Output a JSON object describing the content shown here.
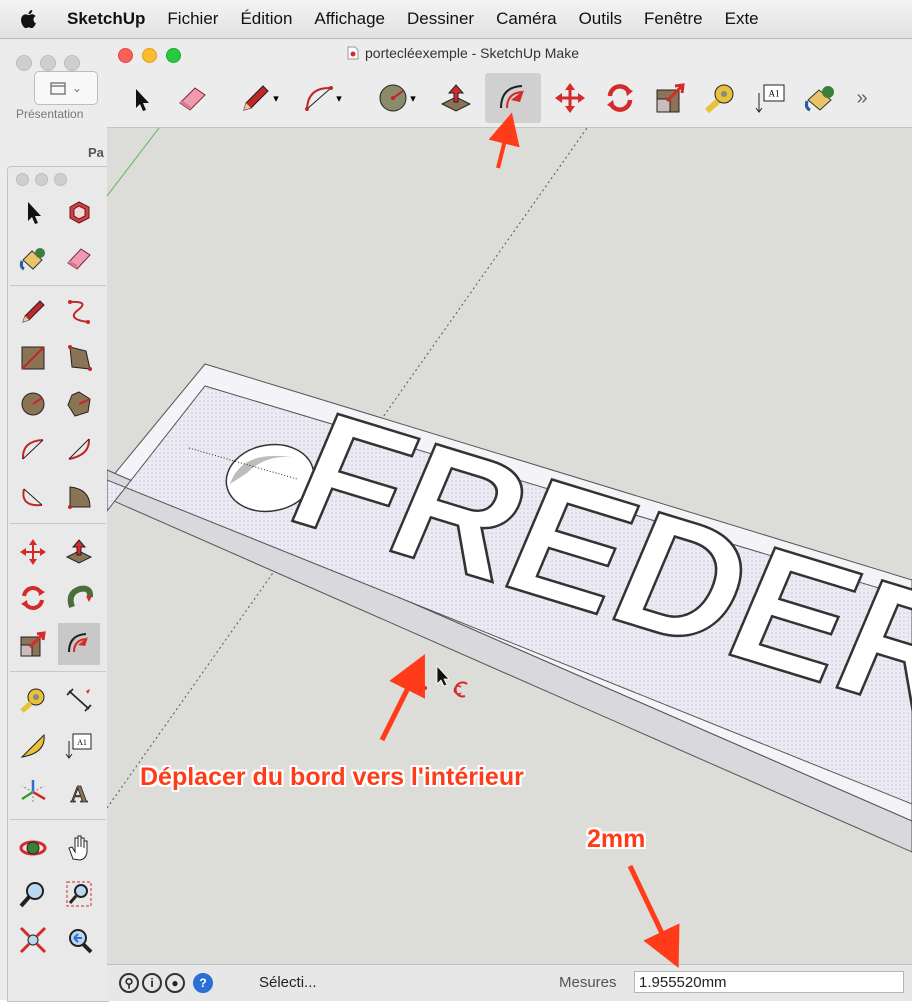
{
  "menubar": {
    "app": "SketchUp",
    "items": [
      "Fichier",
      "Édition",
      "Affichage",
      "Dessiner",
      "Caméra",
      "Outils",
      "Fenêtre",
      "Exte"
    ]
  },
  "background_window": {
    "presentation_label": "Présentation",
    "panel_label": "Pa"
  },
  "window": {
    "title": "portecléexemple - SketchUp Make"
  },
  "toolbar": {
    "overflow": "»",
    "text_tool_label": "A1",
    "icons": [
      "select-icon",
      "eraser-icon",
      "pencil-icon",
      "arc-icon",
      "circle-icon",
      "push-pull-icon",
      "offset-icon",
      "move-icon",
      "rotate-icon",
      "scale-icon",
      "tape-measure-icon",
      "text-icon",
      "paint-bucket-icon"
    ]
  },
  "viewport": {
    "model_text": "FREDER"
  },
  "status": {
    "text": "Sélecti...",
    "mesures_label": "Mesures",
    "mesures_value": "1.955520mm"
  },
  "annotations": {
    "instruction": "Déplacer du bord vers l'intérieur",
    "dimension": "2mm"
  },
  "colors": {
    "annotation": "#ff3b1a",
    "accent_red": "#e02020"
  }
}
